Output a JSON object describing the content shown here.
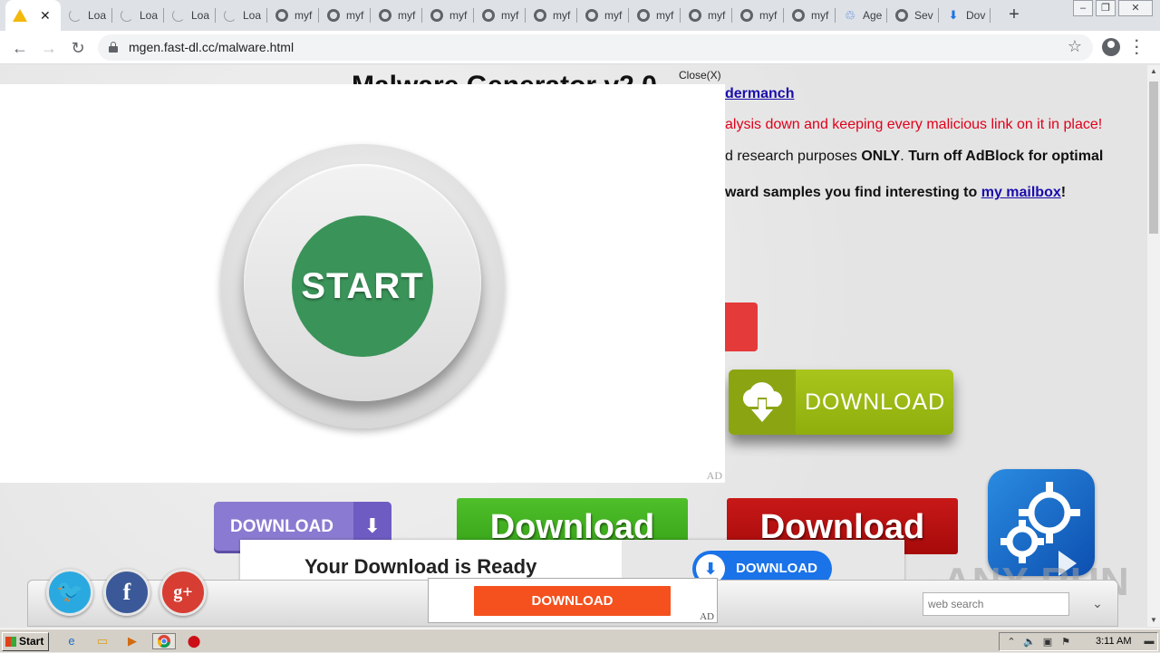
{
  "browser": {
    "tabs": [
      {
        "title": "",
        "icon": "warning-icon",
        "active": true
      },
      {
        "title": "Loa",
        "icon": "loading-icon"
      },
      {
        "title": "Loa",
        "icon": "loading-icon"
      },
      {
        "title": "Loa",
        "icon": "loading-icon"
      },
      {
        "title": "Loa",
        "icon": "loading-icon"
      },
      {
        "title": "myf",
        "icon": "globe-icon"
      },
      {
        "title": "myf",
        "icon": "globe-icon"
      },
      {
        "title": "myf",
        "icon": "globe-icon"
      },
      {
        "title": "myf",
        "icon": "globe-icon"
      },
      {
        "title": "myf",
        "icon": "globe-icon"
      },
      {
        "title": "myf",
        "icon": "globe-icon"
      },
      {
        "title": "myf",
        "icon": "globe-icon"
      },
      {
        "title": "myf",
        "icon": "globe-icon"
      },
      {
        "title": "myf",
        "icon": "globe-icon"
      },
      {
        "title": "myf",
        "icon": "globe-icon"
      },
      {
        "title": "myf",
        "icon": "globe-icon"
      },
      {
        "title": "Age",
        "icon": "recycle-icon"
      },
      {
        "title": "Sev",
        "icon": "globe-icon"
      },
      {
        "title": "Dov",
        "icon": "download-icon"
      }
    ],
    "url": "mgen.fast-dl.cc/malware.html"
  },
  "page": {
    "title": "Malware Generator v2.0",
    "author_link": "dermanch",
    "red_line": "alysis down and keeping every malicious link on it in place!",
    "info_line_a": "d research purposes ",
    "info_line_b": "ONLY",
    "info_line_c": ". ",
    "info_line_d": "Turn off AdBlock for optimal",
    "mail_line_a": "ward samples you find interesting to ",
    "mail_link": "my mailbox",
    "mail_line_b": "!",
    "green_download_label": "DOWNLOAD",
    "purple_download_label": "DOWNLOAD",
    "big_download_green": "Download",
    "big_download_red": "Download",
    "ready_text": "Your Download is Ready",
    "ready_btn": "DOWNLOAD",
    "small_ad_btn": "DOWNLOAD",
    "small_ad_tag": "AD",
    "websearch_placeholder": "web search",
    "watermark": "ANY RUN"
  },
  "popup": {
    "close_label": "Close(X)",
    "start_label": "START",
    "ad_tag": "AD"
  },
  "taskbar": {
    "start_label": "Start",
    "clock": "3:11 AM"
  },
  "colors": {
    "start_green": "#3a9359",
    "download_green": "#a8c51c",
    "download_red": "#c81818",
    "ad_orange": "#f4511e"
  }
}
